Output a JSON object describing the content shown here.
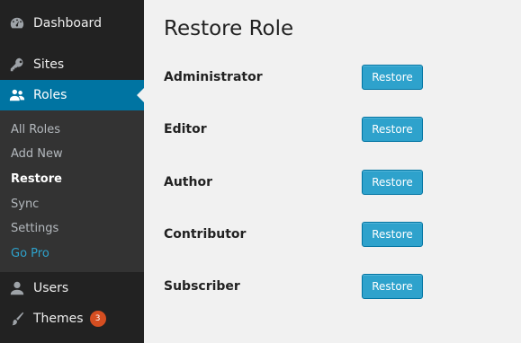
{
  "sidebar": {
    "menu": [
      {
        "label": "Dashboard",
        "icon": "dashboard-icon"
      },
      {
        "label": "Sites",
        "icon": "key-icon"
      },
      {
        "label": "Roles",
        "icon": "users-icon",
        "active": true
      },
      {
        "label": "Users",
        "icon": "user-icon"
      },
      {
        "label": "Themes",
        "icon": "brush-icon",
        "badge": "3"
      }
    ],
    "submenu": [
      "All Roles",
      "Add New",
      "Restore",
      "Sync",
      "Settings",
      "Go Pro"
    ]
  },
  "main": {
    "title": "Restore Role",
    "roles": [
      {
        "label": "Administrator",
        "button": "Restore"
      },
      {
        "label": "Editor",
        "button": "Restore"
      },
      {
        "label": "Author",
        "button": "Restore"
      },
      {
        "label": "Contributor",
        "button": "Restore"
      },
      {
        "label": "Subscriber",
        "button": "Restore"
      }
    ]
  },
  "colors": {
    "sidebar_bg": "#222222",
    "submenu_bg": "#333333",
    "active_bg": "#0074a2",
    "button_bg": "#2ea2cc",
    "badge_bg": "#d54e21",
    "page_bg": "#f1f1f1"
  }
}
